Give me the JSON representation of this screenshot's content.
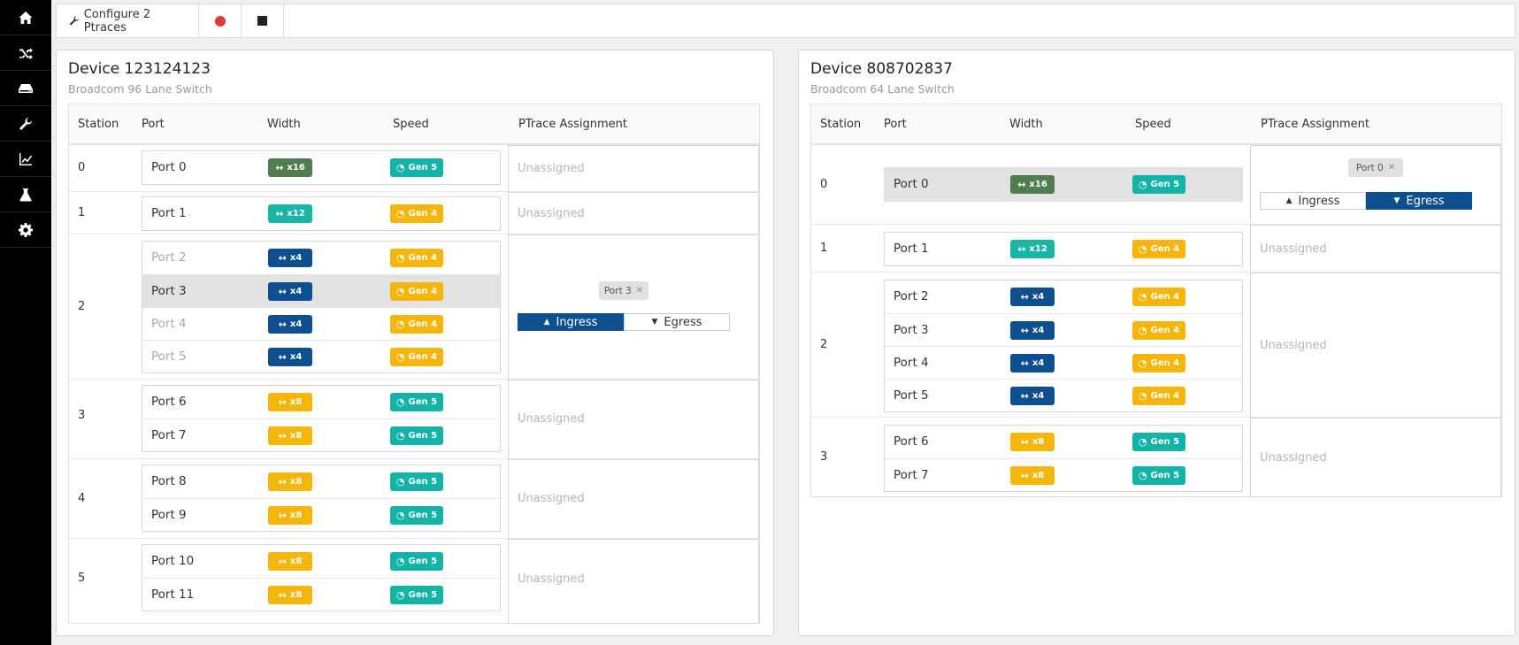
{
  "sidebar": {
    "items": [
      {
        "name": "home-icon"
      },
      {
        "name": "shuffle-icon"
      },
      {
        "name": "hdd-icon"
      },
      {
        "name": "wrench-icon"
      },
      {
        "name": "chart-icon"
      },
      {
        "name": "flask-icon"
      },
      {
        "name": "gear-icon"
      }
    ]
  },
  "toolbar": {
    "configure_label": "Configure 2 Ptraces",
    "record_icon": "record-dot-icon",
    "stop_icon": "stop-square-icon"
  },
  "colors": {
    "width_x16": "#4f7d4f",
    "width_x12": "#1ab5a7",
    "width_x4": "#0e4f8f",
    "width_x8": "#f5b60c",
    "speed_gen5": "#14b3a8",
    "speed_gen4": "#f5b60c",
    "active_toggle": "#0e4f8f",
    "record": "#e0353a"
  },
  "devices": [
    {
      "title": "Device 123124123",
      "subtitle": "Broadcom 96 Lane Switch",
      "headers": {
        "station": "Station",
        "port": "Port",
        "width": "Width",
        "speed": "Speed",
        "assignment": "PTrace Assignment"
      },
      "stations": [
        {
          "num": "0",
          "assignment": "Unassigned",
          "ports": [
            {
              "name": "Port 0",
              "width": "x16",
              "speed": "Gen 5"
            }
          ]
        },
        {
          "num": "1",
          "assignment": "Unassigned",
          "ports": [
            {
              "name": "Port 1",
              "width": "x12",
              "speed": "Gen 4"
            }
          ]
        },
        {
          "num": "2",
          "assigned_port": "Port 3",
          "ingress": "Ingress",
          "egress": "Egress",
          "ports": [
            {
              "name": "Port 2",
              "width": "x4",
              "speed": "Gen 4"
            },
            {
              "name": "Port 3",
              "width": "x4",
              "speed": "Gen 4"
            },
            {
              "name": "Port 4",
              "width": "x4",
              "speed": "Gen 4"
            },
            {
              "name": "Port 5",
              "width": "x4",
              "speed": "Gen 4"
            }
          ]
        },
        {
          "num": "3",
          "assignment": "Unassigned",
          "ports": [
            {
              "name": "Port 6",
              "width": "x8",
              "speed": "Gen 5"
            },
            {
              "name": "Port 7",
              "width": "x8",
              "speed": "Gen 5"
            }
          ]
        },
        {
          "num": "4",
          "assignment": "Unassigned",
          "ports": [
            {
              "name": "Port 8",
              "width": "x8",
              "speed": "Gen 5"
            },
            {
              "name": "Port 9",
              "width": "x8",
              "speed": "Gen 5"
            }
          ]
        },
        {
          "num": "5",
          "assignment": "Unassigned",
          "ports": [
            {
              "name": "Port 10",
              "width": "x8",
              "speed": "Gen 5"
            },
            {
              "name": "Port 11",
              "width": "x8",
              "speed": "Gen 5"
            }
          ]
        }
      ]
    },
    {
      "title": "Device 808702837",
      "subtitle": "Broadcom 64 Lane Switch",
      "headers": {
        "station": "Station",
        "port": "Port",
        "width": "Width",
        "speed": "Speed",
        "assignment": "PTrace Assignment"
      },
      "stations": [
        {
          "num": "0",
          "assigned_port": "Port 0",
          "ingress": "Ingress",
          "egress": "Egress",
          "ports": [
            {
              "name": "Port 0",
              "width": "x16",
              "speed": "Gen 5"
            }
          ]
        },
        {
          "num": "1",
          "assignment": "Unassigned",
          "ports": [
            {
              "name": "Port 1",
              "width": "x12",
              "speed": "Gen 4"
            }
          ]
        },
        {
          "num": "2",
          "assignment": "Unassigned",
          "ports": [
            {
              "name": "Port 2",
              "width": "x4",
              "speed": "Gen 4"
            },
            {
              "name": "Port 3",
              "width": "x4",
              "speed": "Gen 4"
            },
            {
              "name": "Port 4",
              "width": "x4",
              "speed": "Gen 4"
            },
            {
              "name": "Port 5",
              "width": "x4",
              "speed": "Gen 4"
            }
          ]
        },
        {
          "num": "3",
          "assignment": "Unassigned",
          "ports": [
            {
              "name": "Port 6",
              "width": "x8",
              "speed": "Gen 5"
            },
            {
              "name": "Port 7",
              "width": "x8",
              "speed": "Gen 5"
            }
          ]
        }
      ]
    }
  ]
}
